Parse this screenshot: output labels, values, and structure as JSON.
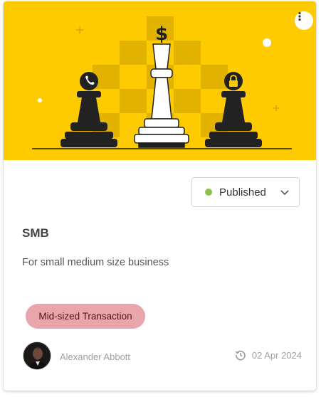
{
  "banner": {
    "background_color": "#fecb01",
    "icon_top": "dollar",
    "icon_left": "phone",
    "icon_right": "lock"
  },
  "menu": {
    "icon": "more-vertical-icon"
  },
  "status": {
    "label": "Published",
    "dot_color": "#8bc34a",
    "icon": "chevron-down-icon"
  },
  "card": {
    "title": "SMB",
    "description": "For small medium size business",
    "tag": "Mid-sized Transaction",
    "tag_color": "#e8a5ac"
  },
  "footer": {
    "author": "Alexander Abbott",
    "date": "02 Apr 2024",
    "date_icon": "history-icon"
  }
}
